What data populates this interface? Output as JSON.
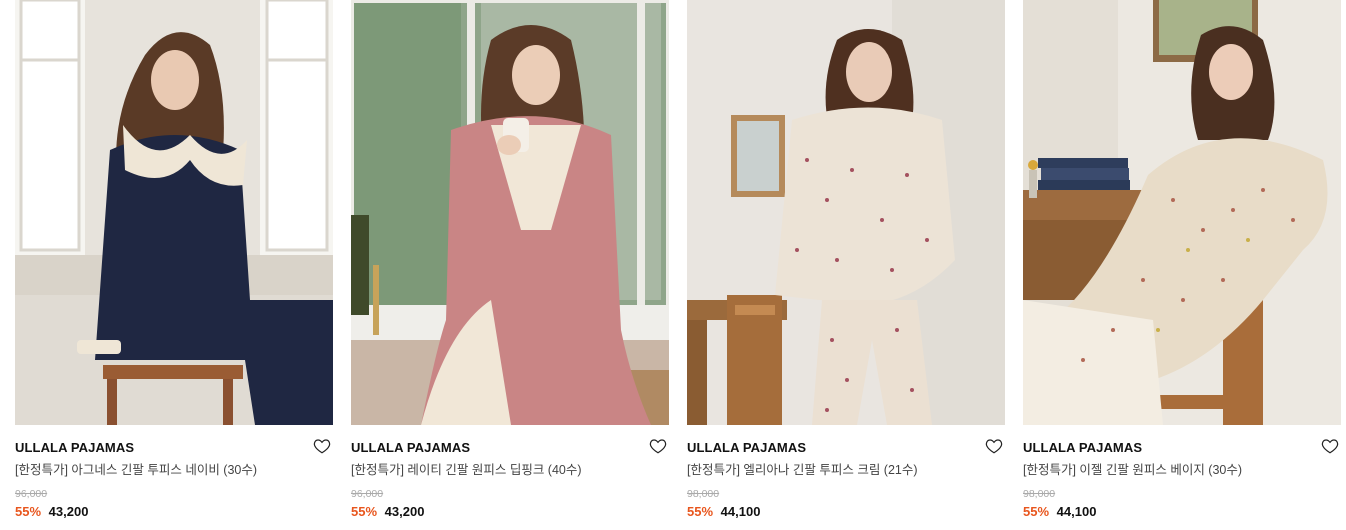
{
  "products": [
    {
      "brand": "ULLALA PAJAMAS",
      "name": "[한정특가] 아그네스 긴팔 투피스 네이비 (30수)",
      "original_price": "96,000",
      "discount": "55%",
      "sale_price": "43,200",
      "image_alt": "Model in navy long-sleeve two-piece pajamas with cream ruffle collar, sitting on a wooden stool by a window",
      "colors": {
        "garment": "#1f2742",
        "trim": "#efe6d6",
        "background": "#e7e3dc"
      }
    },
    {
      "brand": "ULLALA PAJAMAS",
      "name": "[한정특가] 레이티 긴팔 원피스 딥핑크 (40수)",
      "original_price": "96,000",
      "discount": "55%",
      "sale_price": "43,200",
      "image_alt": "Model in deep pink long-sleeve one-piece with cream ruffle bib, holding a candle mug by a window",
      "colors": {
        "garment": "#c98585",
        "trim": "#f1e7d7",
        "background": "#8fa58a"
      }
    },
    {
      "brand": "ULLALA PAJAMAS",
      "name": "[한정특가] 엘리아나 긴팔 투피스 크림 (21수)",
      "original_price": "98,000",
      "discount": "55%",
      "sale_price": "44,100",
      "image_alt": "Model standing in cream floral long-sleeve two-piece pajamas beside a wooden chair",
      "colors": {
        "garment": "#ece3d6",
        "trim": "#a4515f",
        "background": "#e9e5e0"
      }
    },
    {
      "brand": "ULLALA PAJAMAS",
      "name": "[한정특가] 이젤 긴팔 원피스 베이지 (30수)",
      "original_price": "98,000",
      "discount": "55%",
      "sale_price": "44,100",
      "image_alt": "Model seated on a wooden chair in a beige floral long-sleeve one-piece, desk with books behind",
      "colors": {
        "garment": "#e8dcc8",
        "trim": "#b26a58",
        "background": "#ece8e1"
      }
    }
  ],
  "icons": {
    "wishlist": "heart-outline-icon"
  }
}
